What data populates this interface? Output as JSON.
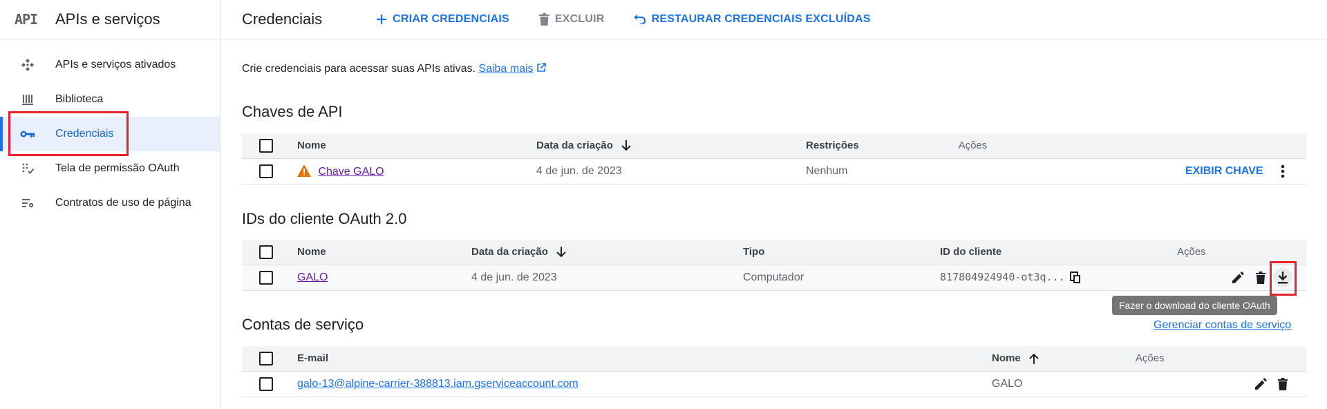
{
  "sidebar": {
    "logo": "API",
    "title": "APIs e serviços",
    "items": [
      {
        "label": "APIs e serviços ativados",
        "icon": "api-diamond-icon"
      },
      {
        "label": "Biblioteca",
        "icon": "library-icon"
      },
      {
        "label": "Credenciais",
        "icon": "key-icon",
        "active": true
      },
      {
        "label": "Tela de permissão OAuth",
        "icon": "oauth-consent-icon"
      },
      {
        "label": "Contratos de uso de página",
        "icon": "settings-list-icon"
      }
    ]
  },
  "topbar": {
    "title": "Credenciais",
    "create_label": "CRIAR CREDENCIAIS",
    "delete_label": "EXCLUIR",
    "restore_label": "RESTAURAR CREDENCIAIS EXCLUÍDAS"
  },
  "intro": {
    "text": "Crie credenciais para acessar suas APIs ativas.",
    "link": "Saiba mais"
  },
  "api_keys": {
    "title": "Chaves de API",
    "columns": [
      "Nome",
      "Data da criação",
      "Restrições",
      "Ações"
    ],
    "rows": [
      {
        "name": "Chave GALO",
        "created": "4 de jun. de 2023",
        "restrictions": "Nenhum",
        "action": "EXIBIR CHAVE"
      }
    ]
  },
  "oauth": {
    "title": "IDs do cliente OAuth 2.0",
    "columns": [
      "Nome",
      "Data da criação",
      "Tipo",
      "ID do cliente",
      "Ações"
    ],
    "rows": [
      {
        "name": "GALO",
        "created": "4 de jun. de 2023",
        "type": "Computador",
        "client_id": "817804924940-ot3q..."
      }
    ],
    "tooltip": "Fazer o download do cliente OAuth"
  },
  "service_accounts": {
    "title": "Contas de serviço",
    "manage_link": "Gerenciar contas de serviço",
    "columns": [
      "E-mail",
      "Nome",
      "Ações"
    ],
    "rows": [
      {
        "email": "galo-13@alpine-carrier-388813.iam.gserviceaccount.com",
        "name": "GALO"
      }
    ]
  },
  "colors": {
    "accent": "#1a73e8",
    "highlight": "#e5212b",
    "warning": "#e37400"
  }
}
